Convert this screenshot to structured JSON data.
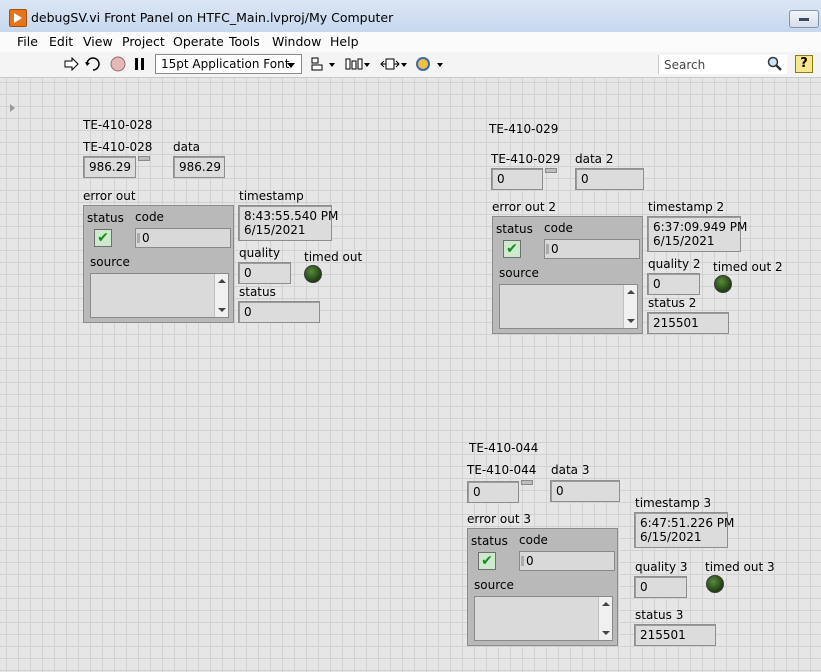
{
  "window": {
    "title": "debugSV.vi Front Panel on HTFC_Main.lvproj/My Computer"
  },
  "menu": [
    "File",
    "Edit",
    "View",
    "Project",
    "Operate",
    "Tools",
    "Window",
    "Help"
  ],
  "toolbar": {
    "font": "15pt Application Font",
    "search_placeholder": "Search",
    "icons": [
      "run-arrow-icon",
      "run-continuously-icon",
      "abort-icon",
      "pause-icon",
      "align-icon",
      "distribute-icon",
      "resize-icon",
      "reorder-icon",
      "search-icon",
      "help-icon"
    ]
  },
  "groups": [
    {
      "title": "TE-410-028",
      "tag_label": "TE-410-028",
      "tag_value": "986.29",
      "data_label": "data",
      "data_value": "986.29",
      "error_label": "error out",
      "status_label": "status",
      "code_label": "code",
      "code_value": "0",
      "source_label": "source",
      "timestamp_label": "timestamp",
      "timestamp_line1": "8:43:55.540 PM",
      "timestamp_line2": "6/15/2021",
      "quality_label": "quality",
      "quality_value": "0",
      "timedout_label": "timed out",
      "status_out_label": "status",
      "status_out_value": "0"
    },
    {
      "title": "TE-410-029",
      "tag_label": "TE-410-029",
      "tag_value": "0",
      "data_label": "data 2",
      "data_value": "0",
      "error_label": "error out 2",
      "status_label": "status",
      "code_label": "code",
      "code_value": "0",
      "source_label": "source",
      "timestamp_label": "timestamp 2",
      "timestamp_line1": "6:37:09.949 PM",
      "timestamp_line2": "6/15/2021",
      "quality_label": "quality 2",
      "quality_value": "0",
      "timedout_label": "timed out 2",
      "status_out_label": "status 2",
      "status_out_value": "215501"
    },
    {
      "title": "TE-410-044",
      "tag_label": "TE-410-044",
      "tag_value": "0",
      "data_label": "data 3",
      "data_value": "0",
      "error_label": "error out 3",
      "status_label": "status",
      "code_label": "code",
      "code_value": "0",
      "source_label": "source",
      "timestamp_label": "timestamp 3",
      "timestamp_line1": "6:47:51.226 PM",
      "timestamp_line2": "6/15/2021",
      "quality_label": "quality 3",
      "quality_value": "0",
      "timedout_label": "timed out 3",
      "status_out_label": "status 3",
      "status_out_value": "215501"
    }
  ]
}
